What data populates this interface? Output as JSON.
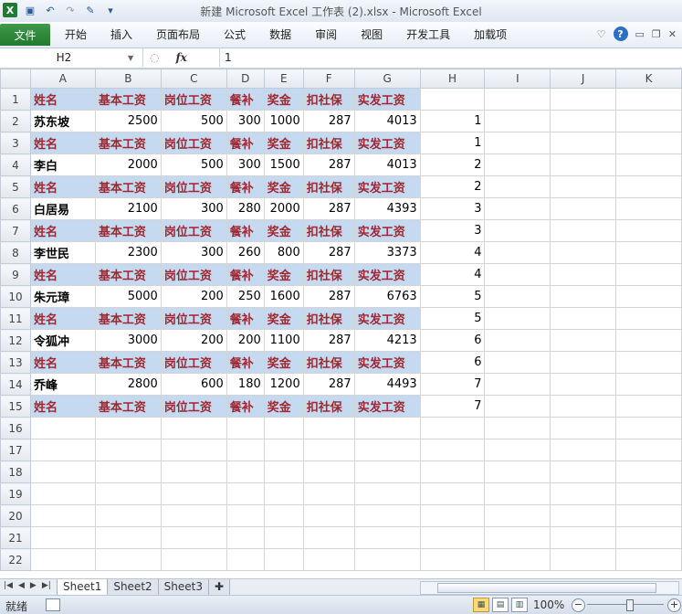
{
  "window": {
    "title": "新建 Microsoft Excel 工作表 (2).xlsx - Microsoft Excel"
  },
  "ribbon": {
    "file_tab": "文件",
    "tabs": [
      "开始",
      "插入",
      "页面布局",
      "公式",
      "数据",
      "审阅",
      "视图",
      "开发工具",
      "加载项"
    ]
  },
  "formula_bar": {
    "name_box": "H2",
    "fx_label": "fx",
    "value": "1"
  },
  "columns": [
    "A",
    "B",
    "C",
    "D",
    "E",
    "F",
    "G",
    "H",
    "I",
    "J",
    "K"
  ],
  "rows": [
    {
      "n": "1",
      "type": "header",
      "cells": [
        "姓名",
        "基本工资",
        "岗位工资",
        "餐补",
        "奖金",
        "扣社保",
        "实发工资",
        ""
      ]
    },
    {
      "n": "2",
      "type": "data",
      "cells": [
        "苏东坡",
        "2500",
        "500",
        "300",
        "1000",
        "287",
        "4013",
        "1"
      ]
    },
    {
      "n": "3",
      "type": "header",
      "cells": [
        "姓名",
        "基本工资",
        "岗位工资",
        "餐补",
        "奖金",
        "扣社保",
        "实发工资",
        "1"
      ]
    },
    {
      "n": "4",
      "type": "data",
      "cells": [
        "李白",
        "2000",
        "500",
        "300",
        "1500",
        "287",
        "4013",
        "2"
      ]
    },
    {
      "n": "5",
      "type": "header",
      "cells": [
        "姓名",
        "基本工资",
        "岗位工资",
        "餐补",
        "奖金",
        "扣社保",
        "实发工资",
        "2"
      ]
    },
    {
      "n": "6",
      "type": "data",
      "cells": [
        "白居易",
        "2100",
        "300",
        "280",
        "2000",
        "287",
        "4393",
        "3"
      ]
    },
    {
      "n": "7",
      "type": "header",
      "cells": [
        "姓名",
        "基本工资",
        "岗位工资",
        "餐补",
        "奖金",
        "扣社保",
        "实发工资",
        "3"
      ]
    },
    {
      "n": "8",
      "type": "data",
      "cells": [
        "李世民",
        "2300",
        "300",
        "260",
        "800",
        "287",
        "3373",
        "4"
      ]
    },
    {
      "n": "9",
      "type": "header",
      "cells": [
        "姓名",
        "基本工资",
        "岗位工资",
        "餐补",
        "奖金",
        "扣社保",
        "实发工资",
        "4"
      ]
    },
    {
      "n": "10",
      "type": "data",
      "cells": [
        "朱元璋",
        "5000",
        "200",
        "250",
        "1600",
        "287",
        "6763",
        "5"
      ]
    },
    {
      "n": "11",
      "type": "header",
      "cells": [
        "姓名",
        "基本工资",
        "岗位工资",
        "餐补",
        "奖金",
        "扣社保",
        "实发工资",
        "5"
      ]
    },
    {
      "n": "12",
      "type": "data",
      "cells": [
        "令狐冲",
        "3000",
        "200",
        "200",
        "1100",
        "287",
        "4213",
        "6"
      ]
    },
    {
      "n": "13",
      "type": "header",
      "cells": [
        "姓名",
        "基本工资",
        "岗位工资",
        "餐补",
        "奖金",
        "扣社保",
        "实发工资",
        "6"
      ]
    },
    {
      "n": "14",
      "type": "data",
      "cells": [
        "乔峰",
        "2800",
        "600",
        "180",
        "1200",
        "287",
        "4493",
        "7"
      ]
    },
    {
      "n": "15",
      "type": "header",
      "cells": [
        "姓名",
        "基本工资",
        "岗位工资",
        "餐补",
        "奖金",
        "扣社保",
        "实发工资",
        "7"
      ]
    },
    {
      "n": "16",
      "type": "empty",
      "cells": []
    },
    {
      "n": "17",
      "type": "empty",
      "cells": []
    },
    {
      "n": "18",
      "type": "empty",
      "cells": []
    },
    {
      "n": "19",
      "type": "empty",
      "cells": []
    },
    {
      "n": "20",
      "type": "empty",
      "cells": []
    },
    {
      "n": "21",
      "type": "empty",
      "cells": []
    },
    {
      "n": "22",
      "type": "empty",
      "cells": []
    }
  ],
  "sheets": [
    "Sheet1",
    "Sheet2",
    "Sheet3"
  ],
  "active_sheet": "Sheet1",
  "status": {
    "ready": "就绪",
    "zoom": "100%"
  },
  "colors": {
    "header_fill": "#c5d9f1",
    "header_text": "#a0282f",
    "file_tab": "#217a2e"
  }
}
